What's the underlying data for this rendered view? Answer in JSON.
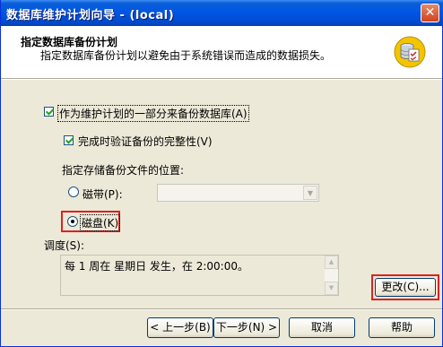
{
  "window": {
    "title": "数据库维护计划向导 - (local)",
    "close_glyph": "✕"
  },
  "header": {
    "title": "指定数据库备份计划",
    "subtitle": "指定数据库备份计划以避免由于系统错误而造成的数据损失。",
    "icon": "database-checklist-icon"
  },
  "options": {
    "backup_as_part": {
      "label": "作为维护计划的一部分来备份数据库(A)",
      "checked": true
    },
    "verify_integrity": {
      "label": "完成时验证备份的完整性(V)",
      "checked": true
    },
    "location_label": "指定存储备份文件的位置:",
    "tape": {
      "label": "磁带(P):",
      "selected": false
    },
    "disk": {
      "label": "磁盘(K)",
      "selected": true
    },
    "tape_combo_value": ""
  },
  "schedule": {
    "label": "调度(S):",
    "value": "每 1 周在 星期日 发生，在 2:00:00。",
    "change_button": "更改(C)..."
  },
  "footer": {
    "back_button": "< 上一步(B)",
    "next_button": "下一步(N) >",
    "cancel_button": "取消",
    "help_button": "帮助"
  },
  "colors": {
    "titlebar": "#0054e3",
    "highlight_box": "#e02020",
    "dialog_bg": "#ece9d8"
  }
}
